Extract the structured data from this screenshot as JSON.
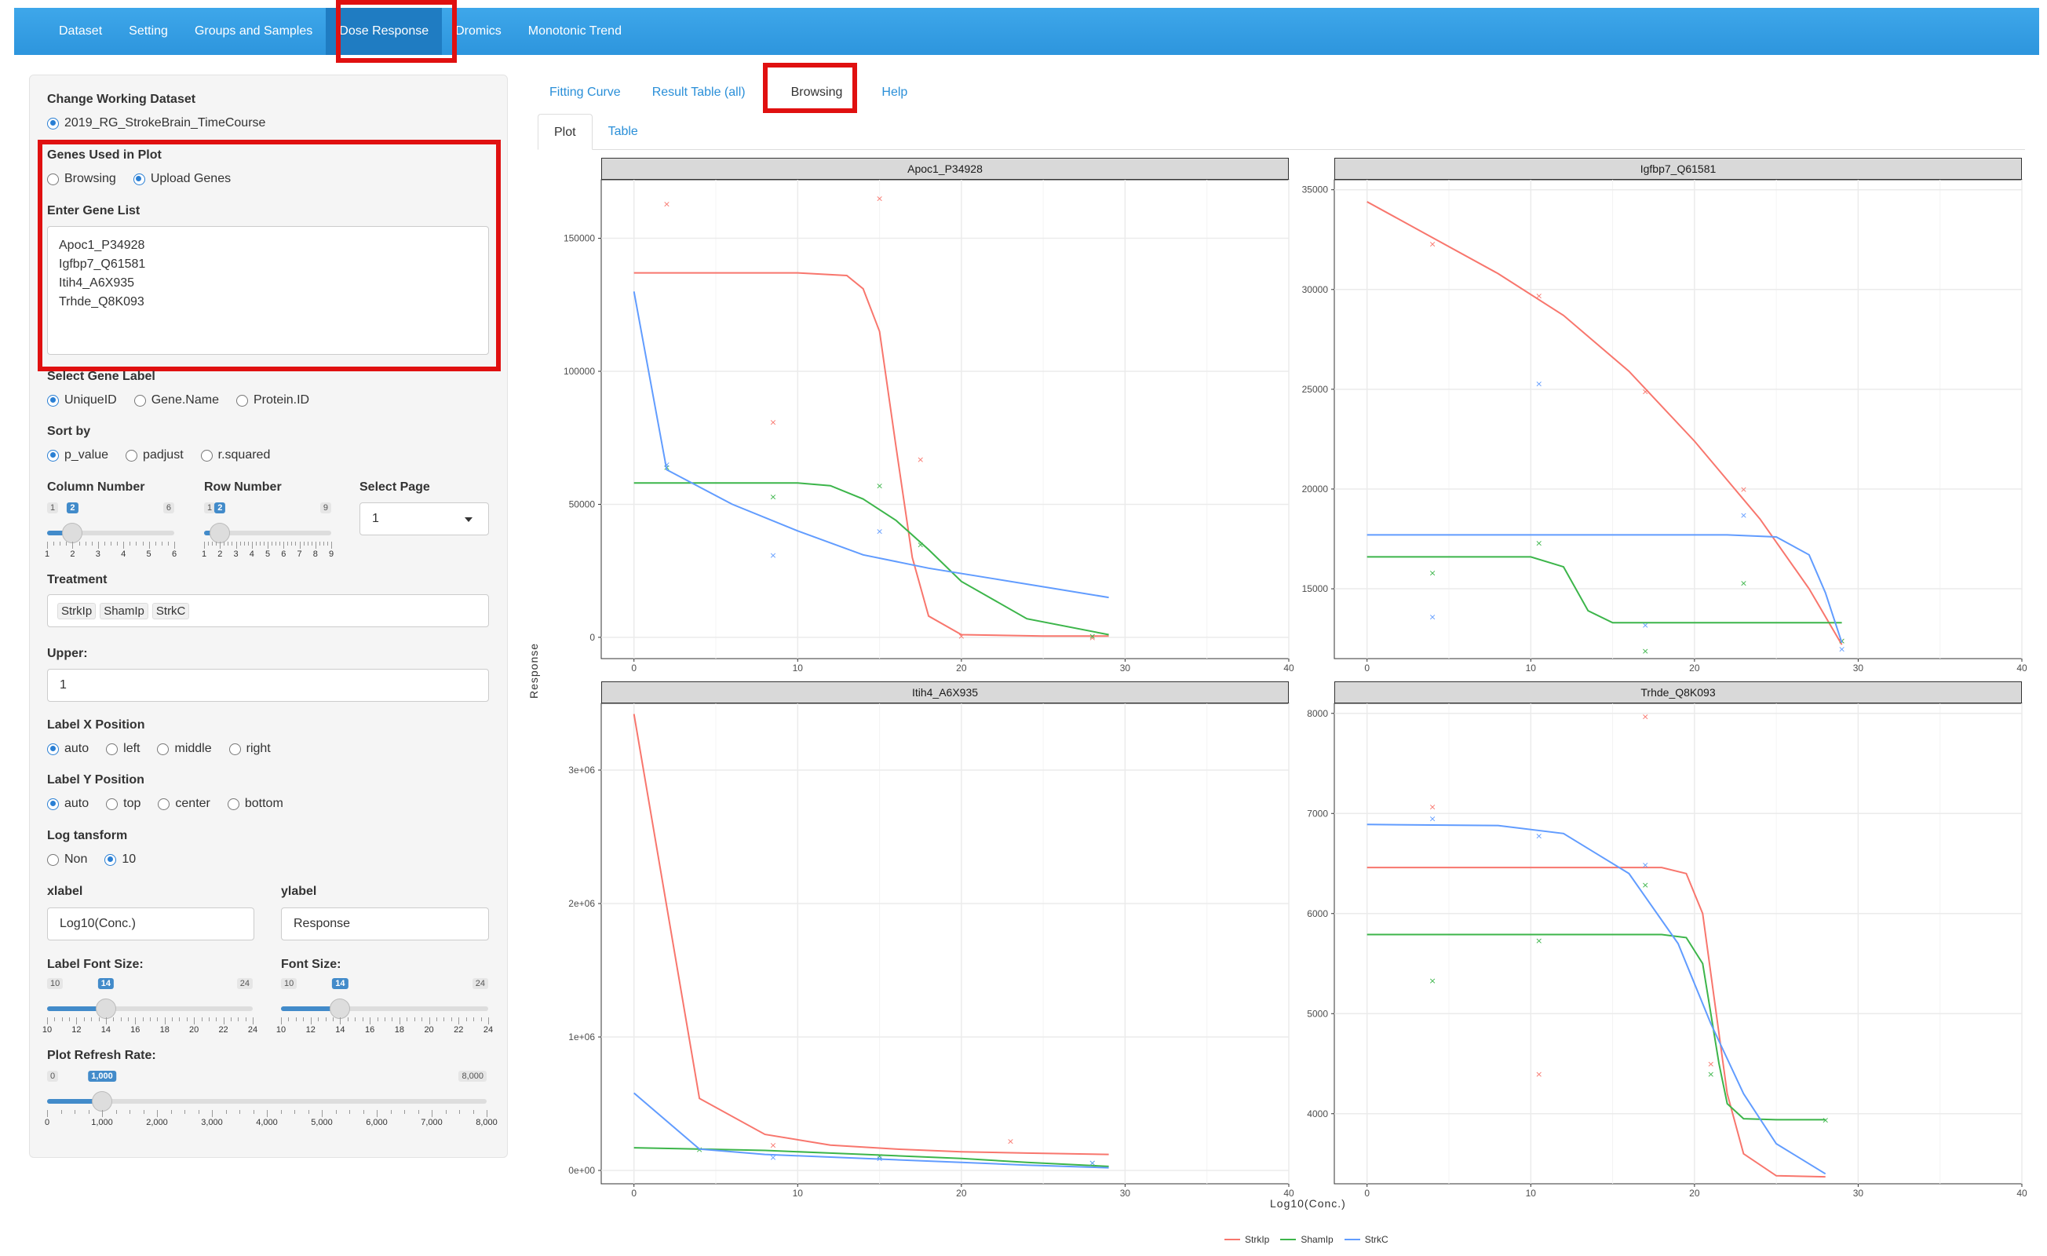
{
  "navbar": {
    "items": [
      "Dataset",
      "Setting",
      "Groups and Samples",
      "Dose Response",
      "Dromics",
      "Monotonic Trend"
    ],
    "active_index": 3
  },
  "sidebar": {
    "change_dataset": {
      "label": "Change Working Dataset",
      "option": "2019_RG_StrokeBrain_TimeCourse"
    },
    "genes_used": {
      "label": "Genes Used in Plot",
      "options": [
        "Browsing",
        "Upload Genes"
      ],
      "selected": "Upload Genes"
    },
    "gene_list": {
      "label": "Enter Gene List",
      "lines": [
        "Apoc1_P34928",
        "Igfbp7_Q61581",
        "Itih4_A6X935",
        "Trhde_Q8K093"
      ]
    },
    "gene_label": {
      "label": "Select Gene Label",
      "options": [
        "UniqueID",
        "Gene.Name",
        "Protein.ID"
      ],
      "selected": "UniqueID"
    },
    "sort_by": {
      "label": "Sort by",
      "options": [
        "p_value",
        "padjust",
        "r.squared"
      ],
      "selected": "p_value"
    },
    "column_number": {
      "label": "Column Number",
      "min": "1",
      "max": "6",
      "value": "2",
      "ticks": [
        "1",
        "2",
        "3",
        "4",
        "5",
        "6"
      ],
      "fraction": 0.2
    },
    "row_number": {
      "label": "Row Number",
      "min": "1",
      "max": "9",
      "value": "2",
      "ticks": [
        "1",
        "2",
        "3",
        "4",
        "5",
        "6",
        "7",
        "8",
        "9"
      ],
      "fraction": 0.125
    },
    "select_page": {
      "label": "Select Page",
      "value": "1"
    },
    "treatment": {
      "label": "Treatment",
      "tags": [
        "StrkIp",
        "ShamIp",
        "StrkC"
      ]
    },
    "upper": {
      "label": "Upper:",
      "value": "1"
    },
    "label_x": {
      "label": "Label X Position",
      "options": [
        "auto",
        "left",
        "middle",
        "right"
      ],
      "selected": "auto"
    },
    "label_y": {
      "label": "Label Y Position",
      "options": [
        "auto",
        "top",
        "center",
        "bottom"
      ],
      "selected": "auto"
    },
    "log_transform": {
      "label": "Log tansform",
      "options": [
        "Non",
        "10"
      ],
      "selected": "10"
    },
    "xlabel": {
      "label": "xlabel",
      "value": "Log10(Conc.)"
    },
    "ylabel": {
      "label": "ylabel",
      "value": "Response"
    },
    "label_font": {
      "label": "Label Font Size:",
      "min": "10",
      "max": "24",
      "value": "14",
      "ticks": [
        "10",
        "12",
        "14",
        "16",
        "18",
        "20",
        "22",
        "24"
      ],
      "fraction": 0.2857
    },
    "font_size": {
      "label": "Font Size:",
      "min": "10",
      "max": "24",
      "value": "14",
      "ticks": [
        "10",
        "12",
        "14",
        "16",
        "18",
        "20",
        "22",
        "24"
      ],
      "fraction": 0.2857
    },
    "refresh_rate": {
      "label": "Plot Refresh Rate:",
      "min": "0",
      "max": "8,000",
      "value": "1,000",
      "ticks": [
        "0",
        "1,000",
        "2,000",
        "3,000",
        "4,000",
        "5,000",
        "6,000",
        "7,000",
        "8,000"
      ],
      "fraction": 0.125
    }
  },
  "tabs": {
    "top": [
      "Fitting Curve",
      "Result Table (all)",
      "Browsing",
      "Help"
    ],
    "top_active": "Browsing",
    "sub": [
      "Plot",
      "Table"
    ],
    "sub_active": "Plot"
  },
  "colors": {
    "StrkIp": "#f8766d",
    "ShamIp": "#3cb54a",
    "StrkC": "#619cff"
  },
  "chart_data": [
    {
      "type": "line",
      "title": "Apoc1_P34928",
      "xlim": [
        -2,
        40
      ],
      "ylim": [
        -8000,
        172000
      ],
      "xticks": [
        0,
        10,
        20,
        30,
        40
      ],
      "yticks": [
        0,
        50000,
        100000,
        150000
      ],
      "ytick_labels": [
        "0",
        "50000",
        "100000",
        "150000"
      ],
      "series": [
        {
          "name": "StrkIp",
          "x": [
            0,
            5,
            10,
            13,
            14,
            15,
            16,
            17,
            18,
            20,
            25,
            29
          ],
          "y": [
            137000,
            137000,
            137000,
            136000,
            131000,
            115000,
            72000,
            30000,
            8000,
            1000,
            500,
            500
          ],
          "points": {
            "x": [
              2,
              8.5,
              15,
              17.5,
              20,
              28
            ],
            "y": [
              163000,
              81000,
              165000,
              67000,
              500,
              0
            ]
          }
        },
        {
          "name": "ShamIp",
          "x": [
            0,
            5,
            10,
            12,
            14,
            16,
            18,
            20,
            24,
            29
          ],
          "y": [
            58000,
            58000,
            58000,
            57000,
            52000,
            44000,
            33000,
            21000,
            7000,
            1000
          ],
          "points": {
            "x": [
              2,
              8.5,
              15,
              17.5,
              28
            ],
            "y": [
              64000,
              53000,
              57000,
              35000,
              500
            ]
          }
        },
        {
          "name": "StrkC",
          "x": [
            0,
            2,
            6,
            10,
            14,
            18,
            22,
            26,
            29
          ],
          "y": [
            130000,
            63000,
            50000,
            40000,
            31000,
            26000,
            22000,
            18000,
            15000
          ],
          "points": {
            "x": [
              2,
              8.5,
              15
            ],
            "y": [
              65000,
              31000,
              40000
            ]
          }
        }
      ]
    },
    {
      "type": "line",
      "title": "Igfbp7_Q61581",
      "xlim": [
        -2,
        40
      ],
      "ylim": [
        11500,
        35500
      ],
      "xticks": [
        0,
        10,
        20,
        30,
        40
      ],
      "yticks": [
        15000,
        20000,
        25000,
        30000,
        35000
      ],
      "ytick_labels": [
        "15000",
        "20000",
        "25000",
        "30000",
        "35000"
      ],
      "series": [
        {
          "name": "StrkIp",
          "x": [
            0,
            4,
            8,
            12,
            16,
            20,
            24,
            27,
            29
          ],
          "y": [
            34400,
            32600,
            30800,
            28700,
            25900,
            22400,
            18500,
            15000,
            12200
          ],
          "points": {
            "x": [
              4,
              10.5,
              17,
              23,
              29
            ],
            "y": [
              32300,
              29700,
              24900,
              20000,
              12400
            ]
          }
        },
        {
          "name": "ShamIp",
          "x": [
            0,
            5,
            10,
            12,
            13.5,
            15,
            18,
            22,
            26,
            29
          ],
          "y": [
            16600,
            16600,
            16600,
            16100,
            13900,
            13300,
            13300,
            13300,
            13300,
            13300
          ],
          "points": {
            "x": [
              4,
              10.5,
              17,
              23,
              29
            ],
            "y": [
              15800,
              17300,
              11900,
              15300,
              12400
            ]
          }
        },
        {
          "name": "StrkC",
          "x": [
            0,
            8,
            16,
            22,
            25,
            27,
            28,
            29
          ],
          "y": [
            17700,
            17700,
            17700,
            17700,
            17600,
            16700,
            14800,
            12300
          ],
          "points": {
            "x": [
              4,
              10.5,
              17,
              23,
              29
            ],
            "y": [
              13600,
              25300,
              13200,
              18700,
              12000
            ]
          }
        }
      ]
    },
    {
      "type": "line",
      "title": "Itih4_A6X935",
      "xlim": [
        -2,
        40
      ],
      "ylim": [
        -100000,
        3500000
      ],
      "xticks": [
        0,
        10,
        20,
        30,
        40
      ],
      "yticks": [
        0,
        1000000,
        2000000,
        3000000
      ],
      "ytick_labels": [
        "0e+00",
        "1e+06",
        "2e+06",
        "3e+06"
      ],
      "series": [
        {
          "name": "StrkIp",
          "x": [
            0,
            4,
            8,
            12,
            16,
            20,
            24,
            29
          ],
          "y": [
            3420000,
            540000,
            270000,
            190000,
            160000,
            140000,
            130000,
            120000
          ],
          "points": {
            "x": [
              8.5,
              23
            ],
            "y": [
              190000,
              220000
            ]
          }
        },
        {
          "name": "ShamIp",
          "x": [
            0,
            4,
            8,
            12,
            16,
            20,
            24,
            29
          ],
          "y": [
            170000,
            160000,
            150000,
            130000,
            110000,
            90000,
            60000,
            30000
          ],
          "points": {
            "x": [
              4,
              15,
              28
            ],
            "y": [
              160000,
              110000,
              60000
            ]
          }
        },
        {
          "name": "StrkC",
          "x": [
            0,
            4,
            8,
            12,
            16,
            20,
            24,
            29
          ],
          "y": [
            580000,
            160000,
            120000,
            100000,
            80000,
            60000,
            40000,
            20000
          ],
          "points": {
            "x": [
              8.5,
              15,
              28
            ],
            "y": [
              100000,
              90000,
              60000
            ]
          }
        }
      ]
    },
    {
      "type": "line",
      "title": "Trhde_Q8K093",
      "xlim": [
        -2,
        40
      ],
      "ylim": [
        3300,
        8100
      ],
      "xticks": [
        0,
        10,
        20,
        30,
        40
      ],
      "yticks": [
        4000,
        5000,
        6000,
        7000,
        8000
      ],
      "ytick_labels": [
        "4000",
        "5000",
        "6000",
        "7000",
        "8000"
      ],
      "series": [
        {
          "name": "StrkIp",
          "x": [
            0,
            10,
            18,
            19.5,
            20.5,
            21,
            21.5,
            22,
            23,
            25,
            28
          ],
          "y": [
            6460,
            6460,
            6460,
            6400,
            6000,
            5400,
            4800,
            4200,
            3600,
            3380,
            3370
          ],
          "points": {
            "x": [
              4,
              10.5,
              17,
              21
            ],
            "y": [
              7070,
              4400,
              7970,
              4500
            ]
          }
        },
        {
          "name": "ShamIp",
          "x": [
            0,
            10,
            18,
            19.5,
            20.5,
            21,
            21.5,
            22,
            23,
            25,
            28
          ],
          "y": [
            5790,
            5790,
            5790,
            5760,
            5500,
            5000,
            4500,
            4100,
            3950,
            3940,
            3940
          ],
          "points": {
            "x": [
              4,
              10.5,
              17,
              21,
              28
            ],
            "y": [
              5330,
              5730,
              6290,
              4400,
              3940
            ]
          }
        },
        {
          "name": "StrkC",
          "x": [
            0,
            8,
            12,
            16,
            19,
            21,
            23,
            25,
            28
          ],
          "y": [
            6890,
            6880,
            6800,
            6400,
            5700,
            4900,
            4200,
            3700,
            3400
          ],
          "points": {
            "x": [
              4,
              10.5,
              17
            ],
            "y": [
              6950,
              6780,
              6490
            ]
          }
        }
      ]
    }
  ],
  "plot_axes": {
    "xlabel": "Log10(Conc.)",
    "ylabel": "Response"
  }
}
